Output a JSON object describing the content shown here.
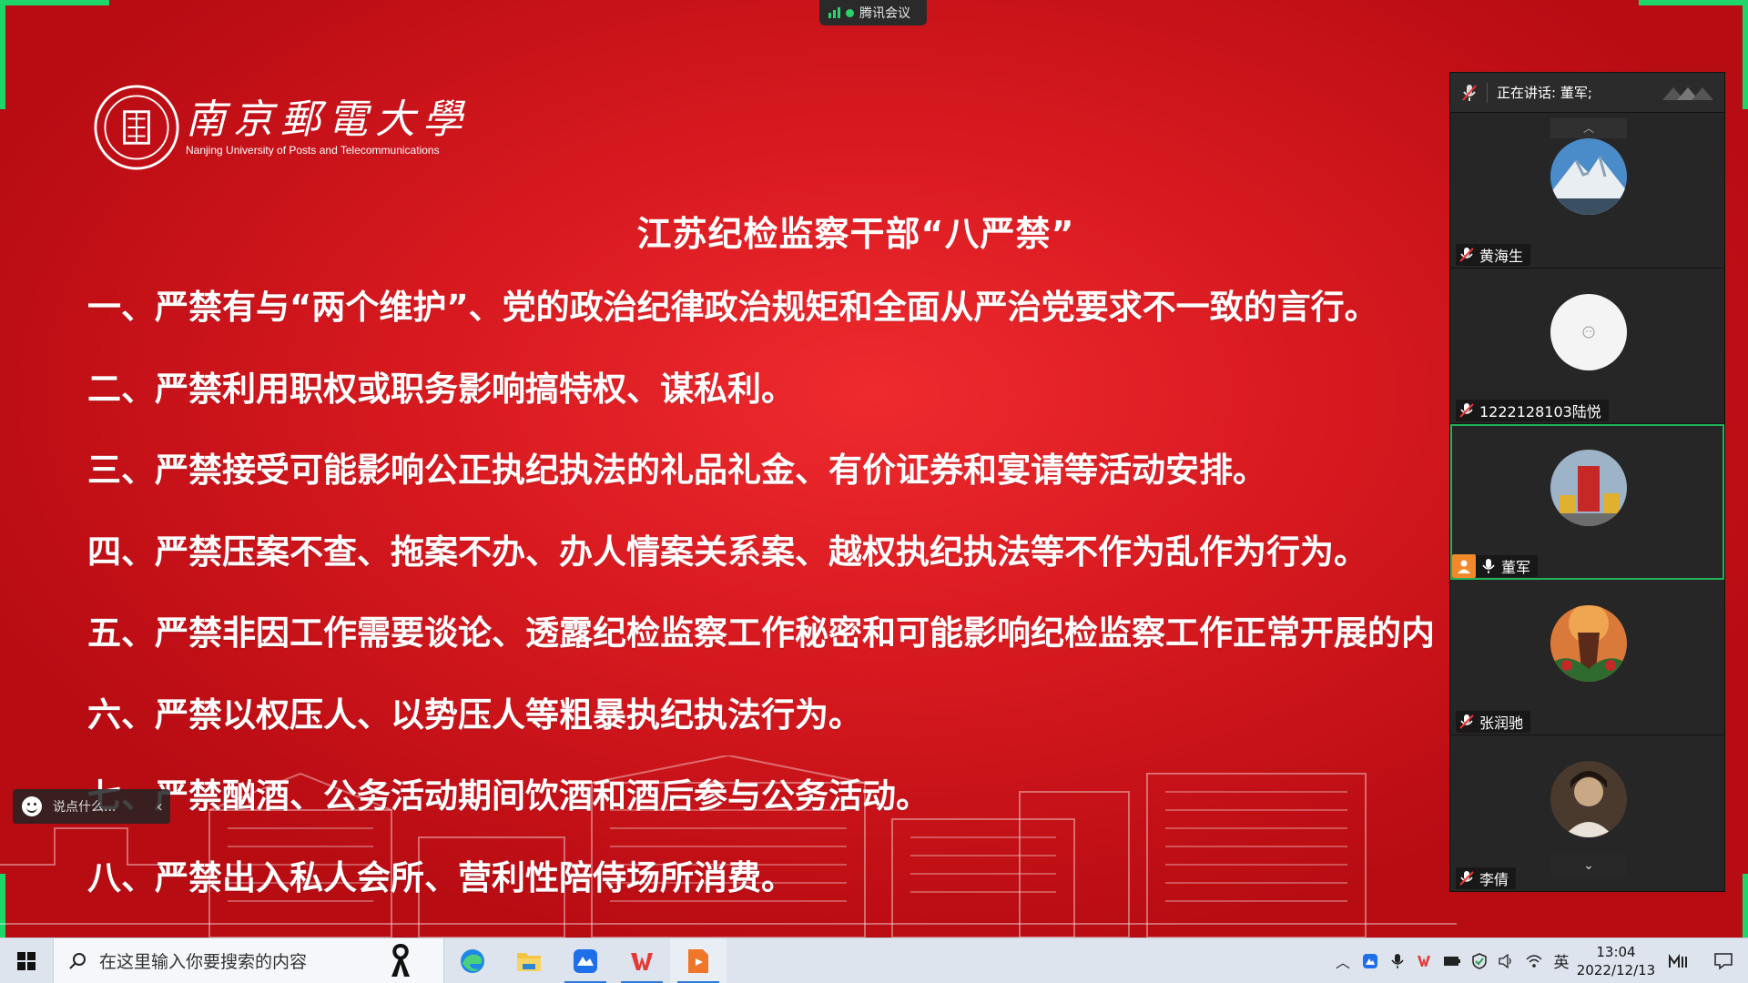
{
  "meeting": {
    "app_name": "腾讯会议"
  },
  "slide": {
    "logo_cn": "南京郵電大學",
    "logo_en": "Nanjing University of Posts and Telecommunications",
    "title": "江苏纪检监察干部“八严禁”",
    "rules": [
      "一、严禁有与“两个维护”、党的政治纪律政治规矩和全面从严治党要求不一致的言行。",
      "二、严禁利用职权或职务影响搞特权、谋私利。",
      "三、严禁接受可能影响公正执纪执法的礼品礼金、有价证券和宴请等活动安排。",
      "四、严禁压案不查、拖案不办、办人情案关系案、越权执纪执法等不作为乱作为行为。",
      "五、严禁非因工作需要谈论、透露纪检监察工作秘密和可能影响纪检监察工作正常开展的内",
      "六、严禁以权压人、以势压人等粗暴执纪执法行为。",
      "七、严禁酗酒、公务活动期间饮酒和酒后参与公务活动。",
      "八、严禁出入私人会所、营利性陪侍场所消费。"
    ]
  },
  "comment_box": {
    "placeholder": "说点什么..."
  },
  "panel": {
    "speaking_label": "正在讲话: 董军;",
    "participants": [
      {
        "name": "黄海生",
        "muted": true,
        "host": false,
        "active": false
      },
      {
        "name": "1222128103陆悦",
        "muted": true,
        "host": false,
        "active": false
      },
      {
        "name": "董军",
        "muted": false,
        "host": true,
        "active": true
      },
      {
        "name": "张润驰",
        "muted": true,
        "host": false,
        "active": false
      },
      {
        "name": "李倩",
        "muted": true,
        "host": false,
        "active": false
      }
    ]
  },
  "taskbar": {
    "search_placeholder": "在这里输入你要搜索的内容",
    "ime": "英",
    "time": "13:04",
    "date": "2022/12/13"
  },
  "colors": {
    "slide_red": "#d81a20",
    "active_green": "#22b35a",
    "host_orange": "#f2882c"
  }
}
